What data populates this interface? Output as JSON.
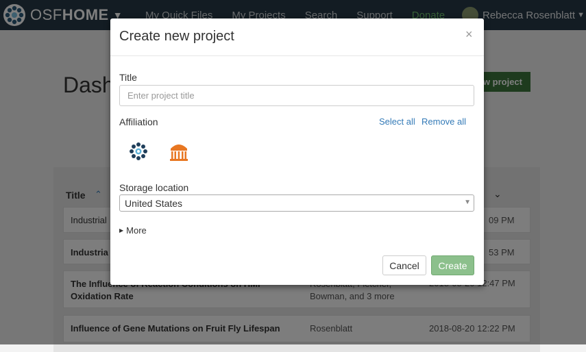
{
  "navbar": {
    "brand_prefix": "OSF",
    "brand_suffix": "HOME",
    "links": [
      "My Quick Files",
      "My Projects",
      "Search",
      "Support",
      "Donate"
    ],
    "user_name": "Rebecca Rosenblatt",
    "bg_color": "#263947",
    "donate_color": "#6fc06f"
  },
  "dashboard": {
    "title": "Dash",
    "new_project_label": "w project",
    "columns": {
      "title": "Title"
    },
    "rows": [
      {
        "title": "Industrial",
        "contributors": "",
        "date": "09 PM"
      },
      {
        "title": "Industria",
        "contributors": "",
        "date": "53 PM"
      },
      {
        "title": "The Influence of Reaction Conditions on HMF Oxidation Rate",
        "contributors": "Rosenblatt, Fletcher, Bowman, and 3 more",
        "date": "2018-08-20 12:47 PM"
      },
      {
        "title": "Influence of Gene Mutations on Fruit Fly Lifespan",
        "contributors": "Rosenblatt",
        "date": "2018-08-20 12:22 PM"
      }
    ]
  },
  "modal": {
    "title": "Create new project",
    "close_glyph": "×",
    "title_label": "Title",
    "title_placeholder": "Enter project title",
    "title_value": "",
    "affiliation_label": "Affiliation",
    "select_all": "Select all",
    "remove_all": "Remove all",
    "institutions": [
      "osf-logo-icon",
      "university-building-icon"
    ],
    "storage_label": "Storage location",
    "storage_value": "United States",
    "more_label": "More",
    "cancel_label": "Cancel",
    "create_label": "Create",
    "create_color": "#8cc08c",
    "link_color": "#337ab7"
  }
}
